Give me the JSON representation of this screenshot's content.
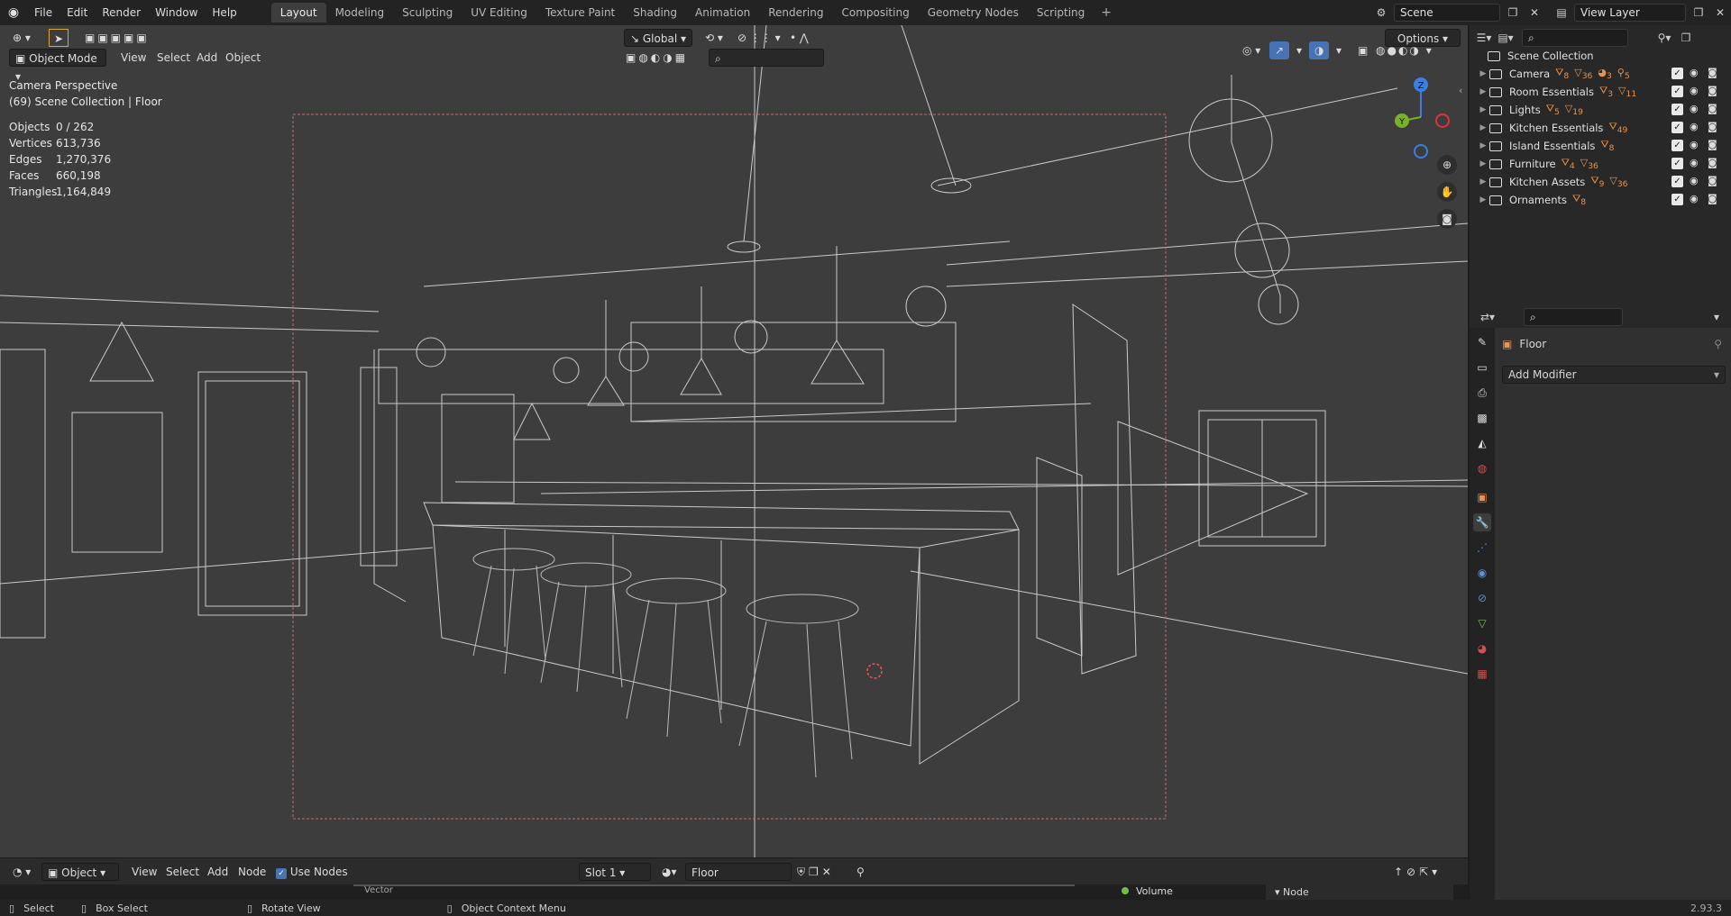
{
  "app": {
    "menu": [
      "File",
      "Edit",
      "Render",
      "Window",
      "Help"
    ],
    "workspaces": [
      "Layout",
      "Modeling",
      "Sculpting",
      "UV Editing",
      "Texture Paint",
      "Shading",
      "Animation",
      "Rendering",
      "Compositing",
      "Geometry Nodes",
      "Scripting"
    ],
    "active_workspace": "Layout",
    "scene": "Scene",
    "view_layer": "View Layer",
    "version": "2.93.3"
  },
  "viewport": {
    "mode": "Object Mode",
    "menu": [
      "View",
      "Select",
      "Add",
      "Object"
    ],
    "transform_orientation": "Global",
    "options_label": "Options",
    "overlay_title": "Camera Perspective",
    "overlay_subtitle": "(69) Scene Collection | Floor",
    "stats": [
      {
        "label": "Objects",
        "value": "0 / 262"
      },
      {
        "label": "Vertices",
        "value": "613,736"
      },
      {
        "label": "Edges",
        "value": "1,270,376"
      },
      {
        "label": "Faces",
        "value": "660,198"
      },
      {
        "label": "Triangles",
        "value": "1,164,849"
      }
    ],
    "gizmo": {
      "y": "Y",
      "z": "Z"
    }
  },
  "outliner": {
    "root": "Scene Collection",
    "items": [
      {
        "name": "Camera",
        "chips": [
          "8",
          "36",
          "3",
          "5"
        ]
      },
      {
        "name": "Room Essentials",
        "chips": [
          "3",
          "11"
        ]
      },
      {
        "name": "Lights",
        "chips": [
          "5",
          "19"
        ]
      },
      {
        "name": "Kitchen Essentials",
        "chips": [
          "49"
        ]
      },
      {
        "name": "Island Essentials",
        "chips": [
          "8"
        ]
      },
      {
        "name": "Furniture",
        "chips": [
          "4",
          "36"
        ]
      },
      {
        "name": "Kitchen Assets",
        "chips": [
          "9",
          "36"
        ]
      },
      {
        "name": "Ornaments",
        "chips": [
          "8"
        ]
      }
    ]
  },
  "properties": {
    "object_name": "Floor",
    "add_modifier": "Add Modifier"
  },
  "shader_editor": {
    "object_type": "Object",
    "menu": [
      "View",
      "Select",
      "Add",
      "Node"
    ],
    "use_nodes": "Use Nodes",
    "slot": "Slot 1",
    "material": "Floor",
    "node_vector": "Vector",
    "node_volume": "Volume",
    "panel_node": "Node"
  },
  "status": {
    "select": "Select",
    "box_select": "Box Select",
    "rotate_view": "Rotate View",
    "context_menu": "Object Context Menu"
  },
  "colors": {
    "accent_blue": "#4772b3",
    "camera_frame": "#c46b6b",
    "orange": "#e9934c",
    "axis_x": "#e0313f",
    "axis_y": "#7ab02b",
    "axis_z": "#3d7fe0"
  }
}
